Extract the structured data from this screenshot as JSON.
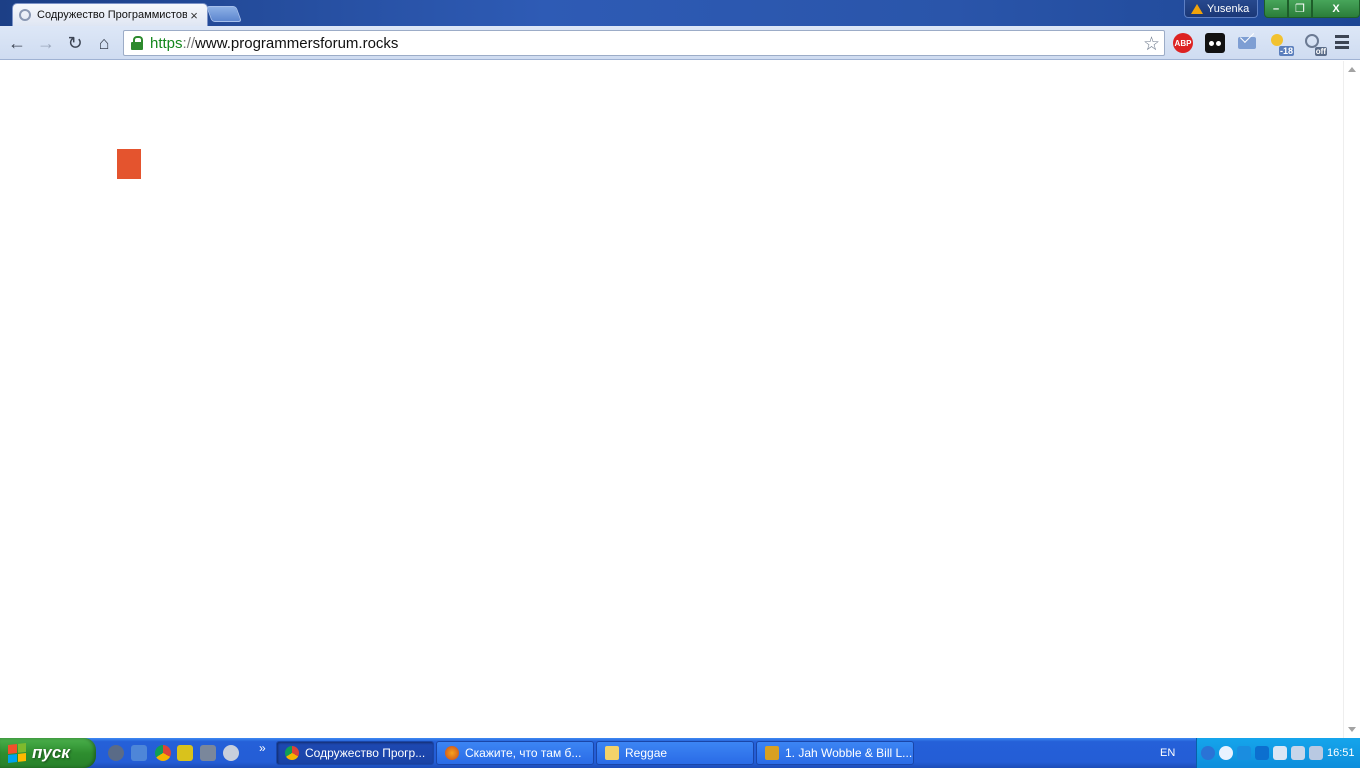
{
  "browser": {
    "tab_title": "Содружество Программистов",
    "tab_close": "×",
    "profile_name": "Yusenka",
    "window_buttons": {
      "minimize": "–",
      "maximize": "❐",
      "close": "X"
    },
    "url": {
      "scheme": "https",
      "separator": "://",
      "host": "www.programmersforum.rocks"
    },
    "extensions": {
      "adblock_label": "ABP",
      "weather_temp": "-18",
      "off_badge": "off"
    }
  },
  "page": {
    "accent_square_color": "#e4542e"
  },
  "taskbar": {
    "start_label": "пуск",
    "quicklaunch_more": "»",
    "buttons": [
      {
        "label": "Содружество Прогр...",
        "icon": "chrome-icon",
        "active": true
      },
      {
        "label": "Скажите, что там б...",
        "icon": "firefox-icon",
        "active": false
      },
      {
        "label": "Reggae",
        "icon": "folder-icon",
        "active": false
      },
      {
        "label": "1. Jah Wobble & Bill L...",
        "icon": "winamp-icon",
        "active": false
      }
    ],
    "language": "EN",
    "clock": "16:51"
  }
}
